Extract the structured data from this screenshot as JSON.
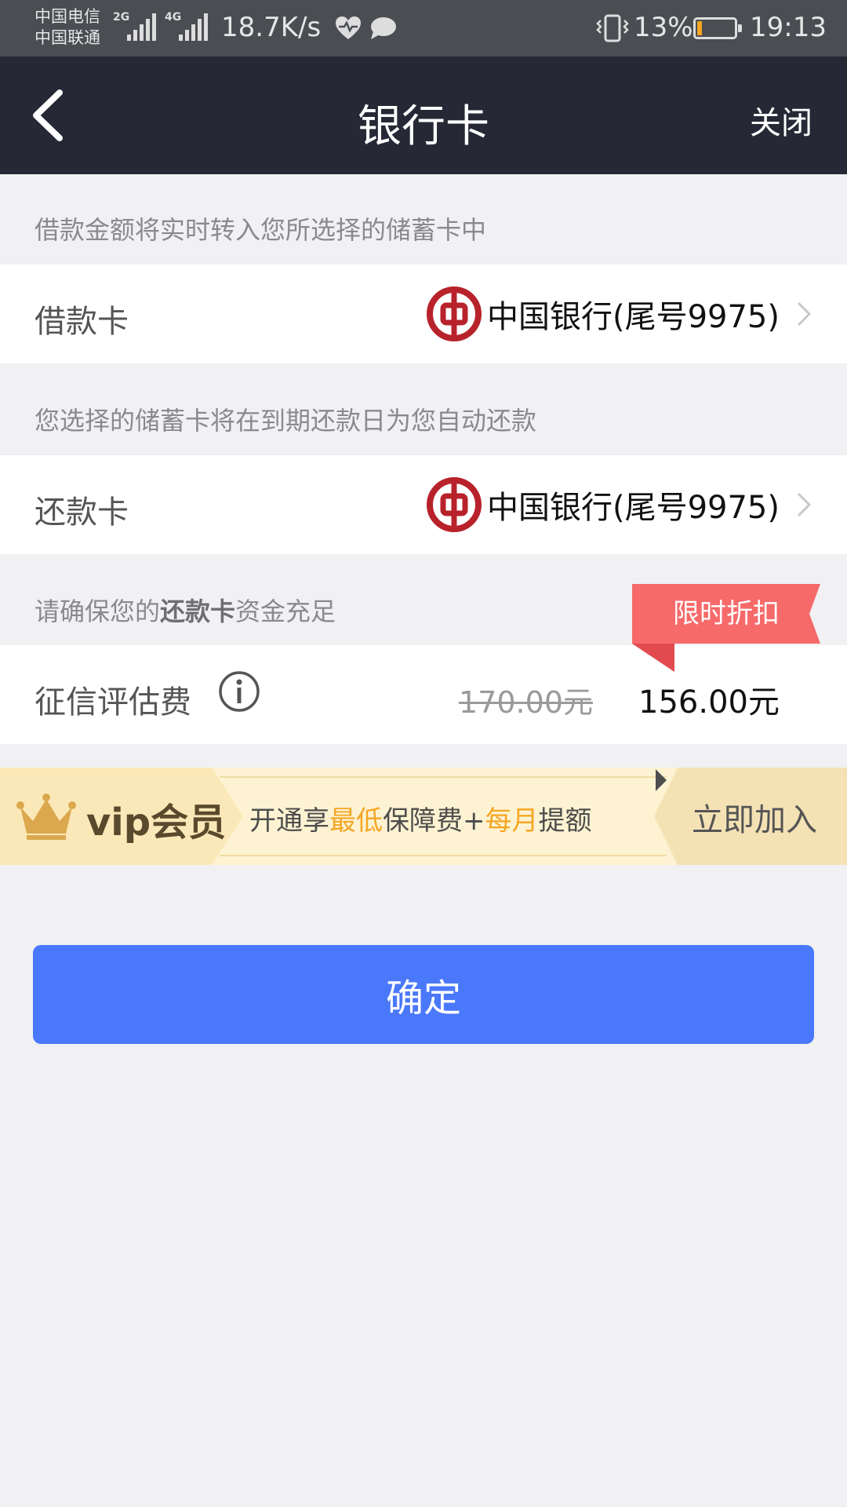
{
  "status_bar": {
    "carrier_1": "中国电信",
    "carrier_2": "中国联通",
    "net_1": "2G",
    "net_2": "4G",
    "speed": "18.7K/s",
    "battery": "13%",
    "battery_level": 0.13,
    "time": "19:13"
  },
  "nav": {
    "title": "银行卡",
    "close_label": "关闭"
  },
  "borrow_section": {
    "hint": "借款金额将实时转入您所选择的储蓄卡中",
    "label": "借款卡",
    "bank": "中国银行(尾号9975)"
  },
  "repay_section": {
    "hint": "您选择的储蓄卡将在到期还款日为您自动还款",
    "label": "还款卡",
    "bank": "中国银行(尾号9975)"
  },
  "fee_section": {
    "hint_prefix": "请确保您的",
    "hint_bold": "还款卡",
    "hint_suffix": "资金充足",
    "promo_tag": "限时折扣",
    "label": "征信评估费",
    "old_price": "170.00元",
    "new_price": "156.00元"
  },
  "vip_banner": {
    "title": "vip会员",
    "slogan_1": "开通享",
    "slogan_hl_1": "最低",
    "slogan_2": "保障费+",
    "slogan_hl_2": "每月",
    "slogan_3": "提额",
    "join_label": "立即加入"
  },
  "confirm_label": "确定",
  "colors": {
    "nav_bg": "#262835",
    "accent_blue": "#4a78fb",
    "promo_red": "#f66a6a",
    "bank_red": "#b8222b",
    "highlight_orange": "#f5a623",
    "vip_bg": "#fdf3d3"
  }
}
